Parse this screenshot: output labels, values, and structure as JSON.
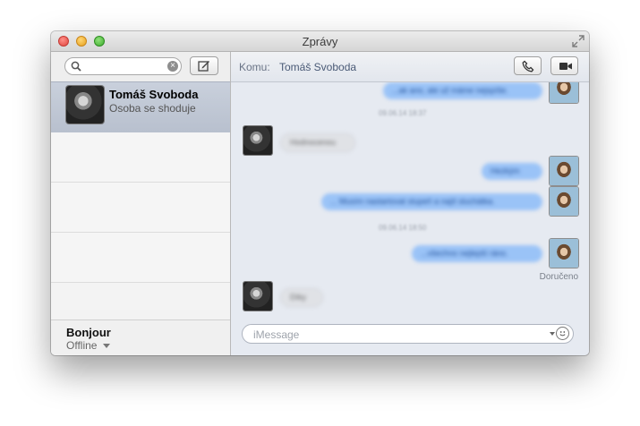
{
  "window": {
    "title": "Zprávy"
  },
  "sidebar": {
    "search": {
      "value": "",
      "placeholder": ""
    },
    "conversations": [
      {
        "name": "Tomáš Svoboda",
        "subtitle": "Osoba se shoduje",
        "selected": true
      }
    ],
    "account": {
      "name": "Bonjour",
      "status": "Offline"
    }
  },
  "chat": {
    "to_label": "Komu:",
    "to_name": "Tomáš Svoboda",
    "delivered_label": "Doručeno",
    "input": {
      "placeholder": "iMessage",
      "value": ""
    },
    "messages": [
      {
        "dir": "out",
        "text": "...ak ano, ale už máme nejspíše."
      },
      {
        "dir": "time",
        "text": "09.06.14 18:37"
      },
      {
        "dir": "in",
        "text": "Hodnocenou"
      },
      {
        "dir": "out",
        "text": "Hezkým"
      },
      {
        "dir": "out",
        "text": "... Musím nastartovat stupeň a najít sluchátka."
      },
      {
        "dir": "time",
        "text": "09.06.14 18:50"
      },
      {
        "dir": "out",
        "text": "...všechno nejlepší ráno."
      },
      {
        "dir": "in",
        "text": "Díky"
      }
    ]
  },
  "colors": {
    "outgoing_bubble": "#9ac3f7",
    "incoming_bubble": "#e0e2e6",
    "selected_row": "#bcc4d2"
  },
  "icons": [
    "fullscreen-icon",
    "search-icon",
    "clear-search-icon",
    "compose-icon",
    "phone-icon",
    "video-camera-icon",
    "emoji-icon"
  ]
}
